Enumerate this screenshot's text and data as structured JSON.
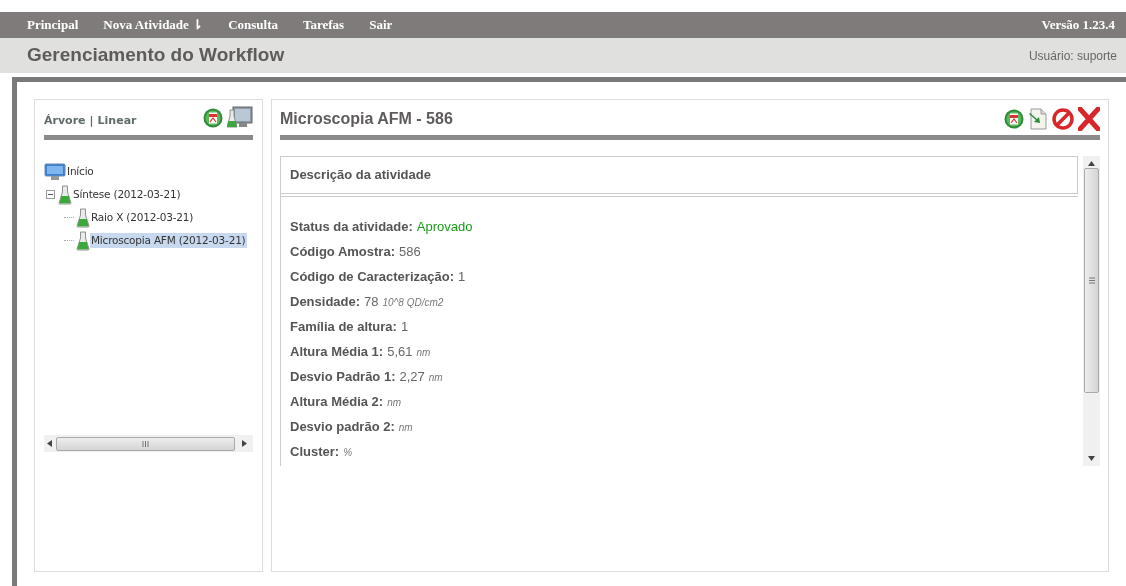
{
  "nav": {
    "items": [
      {
        "label": "Principal"
      },
      {
        "label": "Nova Atividade ⇂"
      },
      {
        "label": "Consulta"
      },
      {
        "label": "Tarefas"
      },
      {
        "label": "Sair"
      }
    ],
    "version": "Versão 1.23.4"
  },
  "header": {
    "title": "Gerenciamento do Workflow",
    "user": "Usuário: suporte"
  },
  "tree_panel": {
    "view_links": [
      {
        "label": "Árvore"
      },
      {
        "label": "Linear"
      }
    ],
    "separator": "|",
    "tree": [
      {
        "label": "Início",
        "kind": "root",
        "selected": false,
        "children": [
          {
            "label": "Síntese (2012-03-21)",
            "kind": "activity",
            "selected": false,
            "expanded": true,
            "children": [
              {
                "label": "Raio X (2012-03-21)",
                "kind": "activity",
                "selected": false
              },
              {
                "label": "Microscopia AFM (2012-03-21)",
                "kind": "activity",
                "selected": true
              }
            ]
          }
        ]
      }
    ]
  },
  "detail": {
    "title": "Microscopia AFM - 586",
    "section_title": "Descrição da atividade",
    "fields": [
      {
        "label": "Status da atividade:",
        "value": "Aprovado",
        "kind": "status"
      },
      {
        "label": "Código Amostra:",
        "value": "586"
      },
      {
        "label": "Código de Caracterização:",
        "value": "1"
      },
      {
        "label": "Densidade:",
        "value": "78",
        "unit": "10^8 QD/cm2"
      },
      {
        "label": "Família de altura:",
        "value": "1"
      },
      {
        "label": "Altura Média 1:",
        "value": "5,61",
        "unit": "nm"
      },
      {
        "label": "Desvio Padrão 1:",
        "value": "2,27",
        "unit": "nm"
      },
      {
        "label": "Altura Média 2:",
        "unit": "nm"
      },
      {
        "label": "Desvio padrão 2:",
        "unit": "nm"
      },
      {
        "label": "Cluster:",
        "unit": "%"
      }
    ]
  }
}
